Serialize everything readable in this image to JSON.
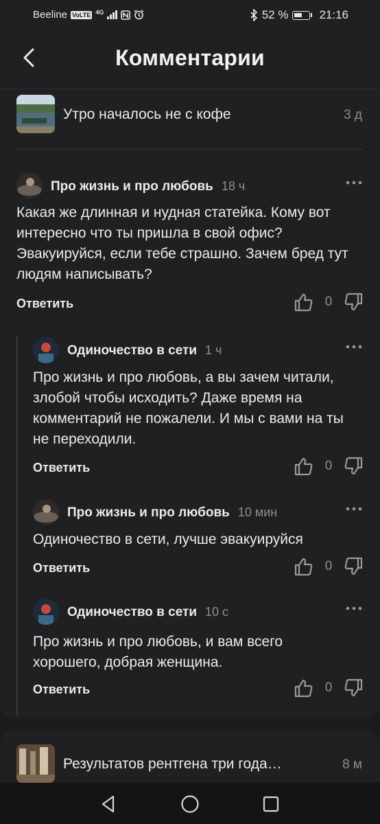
{
  "status_bar": {
    "carrier": "Beeline",
    "volte": "VoLTE",
    "network": "4G",
    "battery": "52 %",
    "time": "21:16"
  },
  "header": {
    "title": "Комментарии"
  },
  "article": {
    "title": "Утро началось не с кофе",
    "age": "3 д"
  },
  "comments": [
    {
      "author": "Про жизнь и про любовь",
      "time": "18 ч",
      "text": "Какая же длинная и нудная статейка. Кому вот интересно что ты пришла в свой офис? Эвакуируйся, если тебе страшно. Зачем бред тут людям написывать?",
      "reply": "Ответить",
      "likes": "0"
    },
    {
      "author": "Одиночество в сети",
      "time": "1 ч",
      "text": "Про жизнь и про любовь, а вы зачем читали, злобой чтобы исходить? Даже время на комментарий не пожалели. И мы с вами на ты не переходили.",
      "reply": "Ответить",
      "likes": "0"
    },
    {
      "author": "Про жизнь и про любовь",
      "time": "10 мин",
      "text": "Одиночество в сети, лучше эвакуируйся",
      "reply": "Ответить",
      "likes": "0"
    },
    {
      "author": "Одиночество в сети",
      "time": "10 с",
      "text": "Про жизнь и про любовь, и вам всего хорошего, добрая женщина.",
      "reply": "Ответить",
      "likes": "0"
    }
  ],
  "next_article": {
    "title": "Результатов рентгена три года…",
    "age": "8 м"
  },
  "icons": {
    "back": "back-arrow-icon",
    "more": "more-dots-icon",
    "like": "thumbs-up-icon",
    "dislike": "thumbs-down-icon",
    "nav_back": "triangle-back-icon",
    "nav_home": "circle-home-icon",
    "nav_recents": "square-recents-icon"
  },
  "colors": {
    "background": "#1b1b1d",
    "card": "#202022",
    "text": "#ececec",
    "muted": "#8e8e92"
  }
}
